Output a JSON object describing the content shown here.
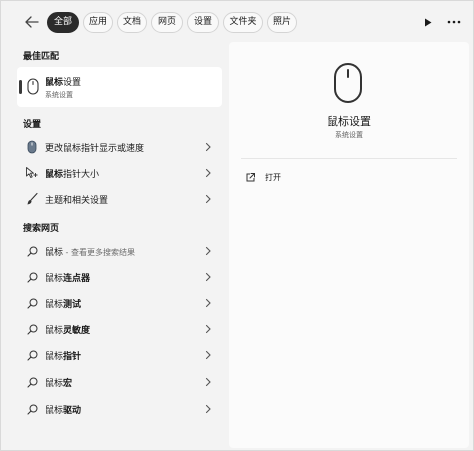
{
  "filters": {
    "tabs": [
      {
        "label": "全部",
        "active": true
      },
      {
        "label": "应用",
        "active": false
      },
      {
        "label": "文档",
        "active": false
      },
      {
        "label": "网页",
        "active": false
      },
      {
        "label": "设置",
        "active": false
      },
      {
        "label": "文件夹",
        "active": false
      },
      {
        "label": "照片",
        "active": false
      }
    ]
  },
  "best_match": {
    "section_title": "最佳匹配",
    "title_bold": "鼠标",
    "title_rest": "设置",
    "subtitle": "系统设置",
    "icon": "mouse-icon"
  },
  "settings": {
    "section_title": "设置",
    "items": [
      {
        "bold": "",
        "rest": "更改鼠标指针显示或速度",
        "icon": "mouse-icon"
      },
      {
        "bold": "鼠标",
        "rest": "指针大小",
        "icon": "pointer-size-icon"
      },
      {
        "bold": "",
        "rest": "主题和相关设置",
        "icon": "brush-icon"
      }
    ]
  },
  "web": {
    "section_title": "搜索网页",
    "items": [
      {
        "bold": "鼠标",
        "rest": "",
        "hint": " - 查看更多搜索结果",
        "icon": "search-icon"
      },
      {
        "bold": "",
        "rest": "鼠标",
        "tail": "连点器",
        "hint": "",
        "icon": "search-icon"
      },
      {
        "bold": "",
        "rest": "鼠标",
        "tail": "测试",
        "hint": "",
        "icon": "search-icon"
      },
      {
        "bold": "",
        "rest": "鼠标",
        "tail": "灵敏度",
        "hint": "",
        "icon": "search-icon"
      },
      {
        "bold": "",
        "rest": "鼠标",
        "tail": "指针",
        "hint": "",
        "icon": "search-icon"
      },
      {
        "bold": "",
        "rest": "鼠标",
        "tail": "宏",
        "hint": "",
        "icon": "search-icon"
      },
      {
        "bold": "",
        "rest": "鼠标",
        "tail": "驱动",
        "hint": "",
        "icon": "search-icon"
      }
    ]
  },
  "preview": {
    "title": "鼠标设置",
    "subtitle": "系统设置",
    "action_label": "打开",
    "icon": "mouse-icon"
  },
  "colors": {
    "background": "#f3f3f3",
    "card": "#ffffff",
    "active_chip": "#2b2b2b"
  }
}
